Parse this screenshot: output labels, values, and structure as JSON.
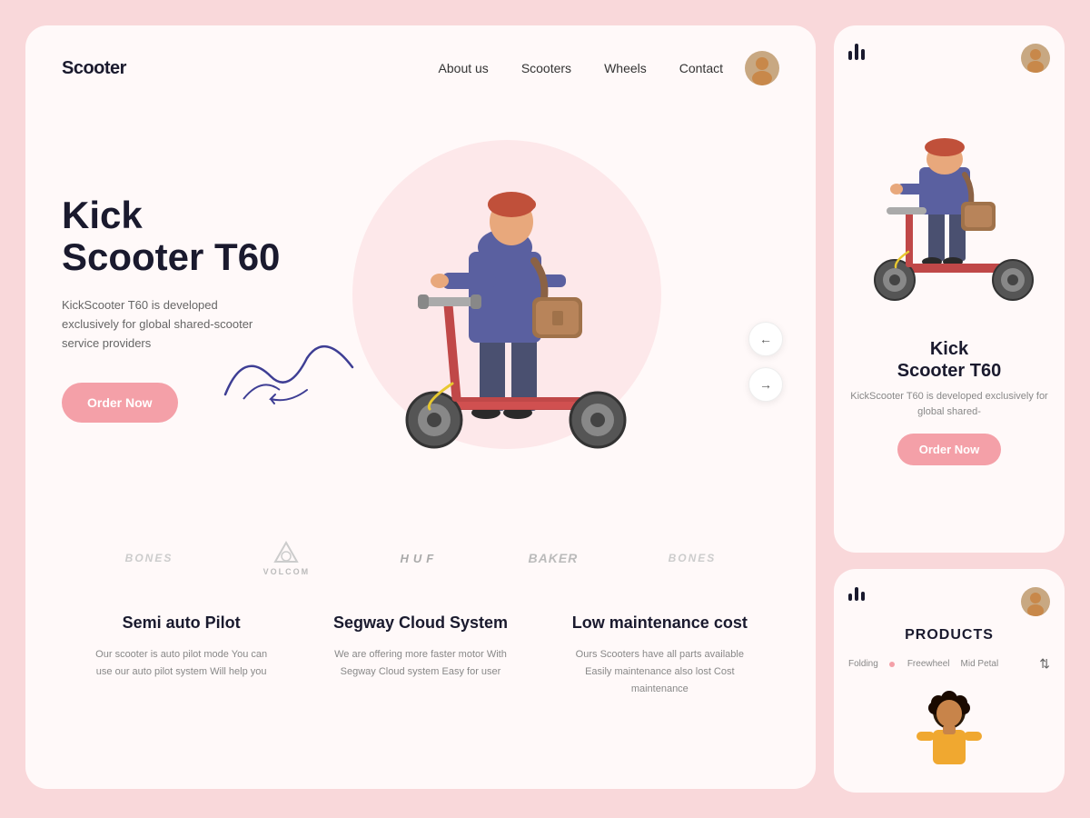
{
  "brand": {
    "logo": "Scooter"
  },
  "navbar": {
    "links": [
      {
        "id": "about",
        "label": "About us"
      },
      {
        "id": "scooters",
        "label": "Scooters"
      },
      {
        "id": "wheels",
        "label": "Wheels"
      },
      {
        "id": "contact",
        "label": "Contact"
      }
    ]
  },
  "hero": {
    "title_line1": "Kick",
    "title_line2": "Scooter T60",
    "description": "KickScooter T60 is developed exclusively for global shared-scooter service providers",
    "cta_label": "Order Now",
    "arrow_prev": "←",
    "arrow_next": "→"
  },
  "brands": [
    {
      "name": "BONES"
    },
    {
      "name": "VOLCOM"
    },
    {
      "name": "HUF"
    },
    {
      "name": "BAKER"
    },
    {
      "name": "BONES"
    }
  ],
  "features": [
    {
      "title": "Semi auto Pilot",
      "desc": "Our scooter is auto pilot mode\nYou can use our auto pilot system\nWill help you"
    },
    {
      "title": "Segway Cloud System",
      "desc": "We are offering more faster motor\nWith Segway Cloud system\nEasy for user"
    },
    {
      "title": "Low maintenance cost",
      "desc": "Ours Scooters have all parts available\nEasily maintenance also lost\nCost  maintenance"
    }
  ],
  "right_card_top": {
    "product_title_line1": "Kick",
    "product_title_line2": "Scooter T60",
    "product_desc": "KickScooter T60 is developed exclusively for global shared-",
    "cta_label": "Order Now"
  },
  "right_card_bottom": {
    "section_title": "PRODUCTS",
    "tabs": [
      {
        "label": "Folding",
        "active": false
      },
      {
        "label": "Freewheel",
        "active": true,
        "dot": true
      },
      {
        "label": "Mid Petal",
        "active": false
      }
    ]
  }
}
